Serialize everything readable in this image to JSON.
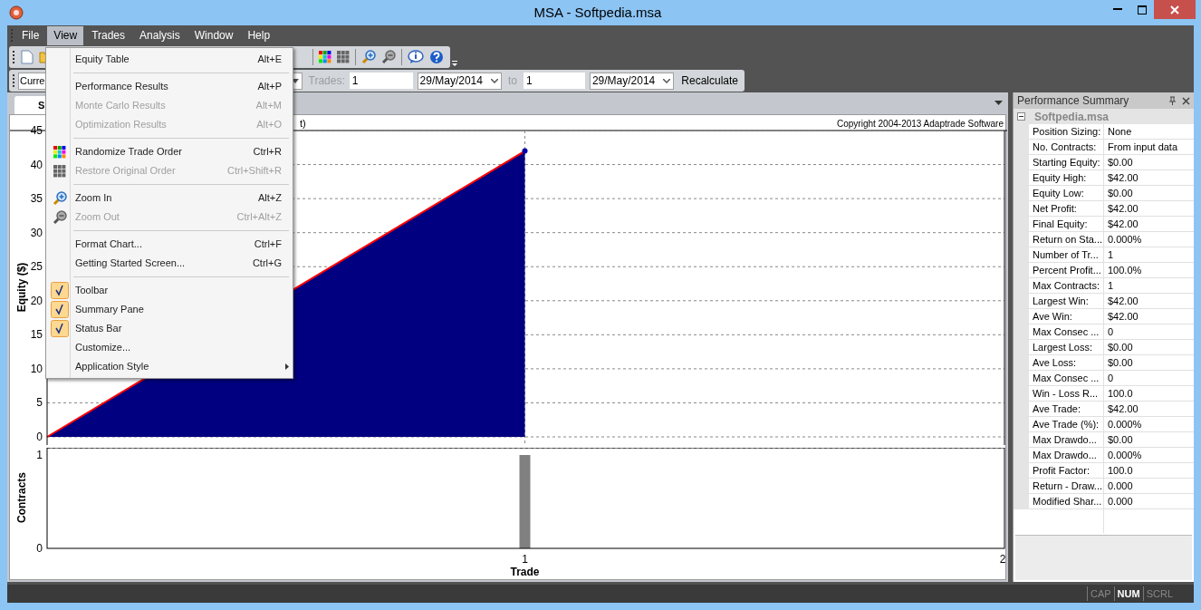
{
  "window": {
    "title": "MSA - Softpedia.msa"
  },
  "menu_bar": [
    {
      "label": "File",
      "selected": false
    },
    {
      "label": "View",
      "selected": true
    },
    {
      "label": "Trades",
      "selected": false
    },
    {
      "label": "Analysis",
      "selected": false
    },
    {
      "label": "Window",
      "selected": false
    },
    {
      "label": "Help",
      "selected": false
    }
  ],
  "view_menu": [
    {
      "kind": "item",
      "label": "Equity Table",
      "shortcut": "Alt+E",
      "disabled": false,
      "checked": false
    },
    {
      "kind": "separator"
    },
    {
      "kind": "item",
      "label": "Performance Results",
      "shortcut": "Alt+P",
      "disabled": false,
      "checked": false
    },
    {
      "kind": "item",
      "label": "Monte Carlo Results",
      "shortcut": "Alt+M",
      "disabled": true,
      "checked": false
    },
    {
      "kind": "item",
      "label": "Optimization Results",
      "shortcut": "Alt+O",
      "disabled": true,
      "checked": false
    },
    {
      "kind": "separator"
    },
    {
      "kind": "item",
      "label": "Randomize Trade Order",
      "shortcut": "Ctrl+R",
      "disabled": false,
      "checked": false
    },
    {
      "kind": "item",
      "label": "Restore Original Order",
      "shortcut": "Ctrl+Shift+R",
      "disabled": true,
      "checked": false
    },
    {
      "kind": "separator"
    },
    {
      "kind": "item",
      "label": "Zoom In",
      "shortcut": "Alt+Z",
      "disabled": false,
      "checked": false
    },
    {
      "kind": "item",
      "label": "Zoom Out",
      "shortcut": "Ctrl+Alt+Z",
      "disabled": true,
      "checked": false
    },
    {
      "kind": "separator"
    },
    {
      "kind": "item",
      "label": "Format Chart...",
      "shortcut": "Ctrl+F",
      "disabled": false,
      "checked": false
    },
    {
      "kind": "item",
      "label": "Getting Started Screen...",
      "shortcut": "Ctrl+G",
      "disabled": false,
      "checked": false
    },
    {
      "kind": "separator"
    },
    {
      "kind": "item",
      "label": "Toolbar",
      "disabled": false,
      "checked": true
    },
    {
      "kind": "item",
      "label": "Summary Pane",
      "disabled": false,
      "checked": true
    },
    {
      "kind": "item",
      "label": "Status Bar",
      "disabled": false,
      "checked": true
    },
    {
      "kind": "item",
      "label": "Customize...",
      "disabled": false,
      "checked": false
    },
    {
      "kind": "submenu",
      "label": "Application Style",
      "disabled": false,
      "checked": false
    }
  ],
  "filter_bar": {
    "mode": "Curre",
    "trades_label": "Trades:",
    "from_trade": "1",
    "from_date": "29/May/2014",
    "to_label": "to",
    "to_trade": "1",
    "to_date": "29/May/2014",
    "button": "Recalculate"
  },
  "document_tab": {
    "label": "S",
    "selected": true
  },
  "equity_chart": {
    "copyright": "Copyright 2004-2013 Adaptrade Software",
    "chart_data": {
      "type": "area",
      "grid": true,
      "title": "t)",
      "ylabel": "Equity ($)",
      "x": [
        0,
        1
      ],
      "series": [
        {
          "color": "#000080",
          "values": [
            0,
            42
          ]
        }
      ],
      "xlim": [
        0,
        2
      ],
      "ylim": [
        0,
        45
      ],
      "yticks": [
        0,
        5,
        10,
        15,
        20,
        25,
        30,
        35,
        40,
        45
      ]
    }
  },
  "contracts_chart": {
    "chart_data": {
      "type": "bar",
      "xlabel": "Trade",
      "ylabel": "Contracts",
      "x": [
        1
      ],
      "values": [
        1
      ],
      "xlim": [
        0,
        2
      ],
      "ylim": [
        0,
        1
      ],
      "xticks": [
        1,
        2
      ],
      "yticks": [
        0,
        1
      ]
    }
  },
  "summary_pane": {
    "title": "Performance Summary",
    "root": {
      "label": "Softpedia.msa",
      "expanded": true
    },
    "rows": [
      {
        "label": "Position Sizing:",
        "value": "None"
      },
      {
        "label": "No. Contracts:",
        "value": "From input data"
      },
      {
        "label": "Starting Equity:",
        "value": "$0.00"
      },
      {
        "label": "Equity High:",
        "value": "$42.00"
      },
      {
        "label": "Equity Low:",
        "value": "$0.00"
      },
      {
        "label": "Net Profit:",
        "value": "$42.00"
      },
      {
        "label": "Final Equity:",
        "value": "$42.00"
      },
      {
        "label": "Return on Sta...",
        "value": "0.000%"
      },
      {
        "label": "Number of Tr...",
        "value": "1"
      },
      {
        "label": "Percent Profit...",
        "value": "100.0%"
      },
      {
        "label": "Max Contracts:",
        "value": "1"
      },
      {
        "label": "Largest Win:",
        "value": "$42.00"
      },
      {
        "label": "Ave Win:",
        "value": "$42.00"
      },
      {
        "label": "Max Consec ...",
        "value": "0"
      },
      {
        "label": "Largest Loss:",
        "value": "$0.00"
      },
      {
        "label": "Ave Loss:",
        "value": "$0.00"
      },
      {
        "label": "Max Consec ...",
        "value": "0"
      },
      {
        "label": "Win - Loss R...",
        "value": "100.0"
      },
      {
        "label": "Ave Trade:",
        "value": "$42.00"
      },
      {
        "label": "Ave Trade (%):",
        "value": "0.000%"
      },
      {
        "label": "Max Drawdo...",
        "value": "$0.00"
      },
      {
        "label": "Max Drawdo...",
        "value": "0.000%"
      },
      {
        "label": "Profit Factor:",
        "value": "100.0"
      },
      {
        "label": "Return - Draw...",
        "value": "0.000"
      },
      {
        "label": "Modified Shar...",
        "value": "0.000"
      }
    ]
  },
  "status_bar": [
    {
      "label": "CAP",
      "on": false
    },
    {
      "label": "NUM",
      "on": true
    },
    {
      "label": "SCRL",
      "on": false
    }
  ]
}
